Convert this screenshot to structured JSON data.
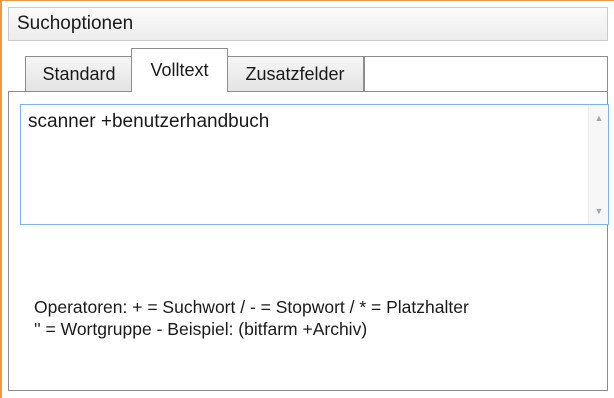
{
  "panel": {
    "title": "Suchoptionen"
  },
  "tabs": [
    {
      "label": "Standard",
      "active": false
    },
    {
      "label": "Volltext",
      "active": true
    },
    {
      "label": "Zusatzfelder",
      "active": false
    }
  ],
  "fulltext": {
    "query": "scanner +benutzerhandbuch",
    "scroll_up_icon": "triangle-up",
    "scroll_down_icon": "triangle-down"
  },
  "help": {
    "line1": "Operatoren: + = Suchwort / - = Stopwort / * = Platzhalter",
    "line2": "'' = Wortgruppe - Beispiel: (bitfarm +Archiv)"
  },
  "colors": {
    "accent_border": "#e99a4a",
    "focus_border": "#7eb4ea"
  }
}
